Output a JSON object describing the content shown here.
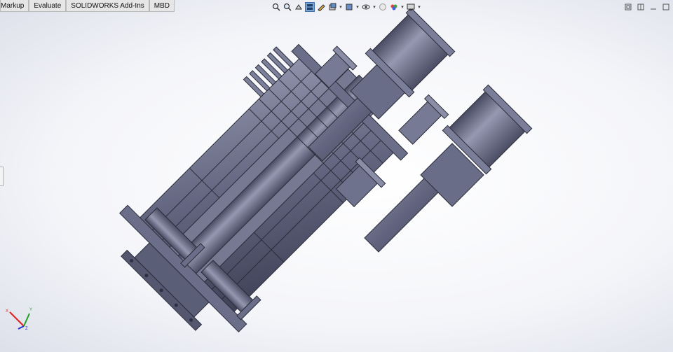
{
  "tabs": [
    {
      "label": "Markup",
      "clipped": true
    },
    {
      "label": "Evaluate"
    },
    {
      "label": "SOLIDWORKS Add-Ins"
    },
    {
      "label": "MBD"
    }
  ],
  "hud_icons": [
    "zoom-to-fit-icon",
    "zoom-to-area-icon",
    "previous-view-icon",
    "section-view-icon",
    "dynamic-annotation-icon",
    "view-orientation-icon",
    "display-style-icon",
    "hide-show-items-icon",
    "edit-appearance-icon",
    "apply-scene-icon",
    "view-settings-icon"
  ],
  "triad": {
    "x_label": "X",
    "y_label": "Y",
    "z_label": "Z"
  },
  "colors": {
    "model_fill": "#61647e",
    "model_dark": "#3f4257",
    "model_light": "#8d90a8",
    "axis_x": "#e02020",
    "axis_y": "#20a020",
    "axis_z": "#2030d0"
  }
}
